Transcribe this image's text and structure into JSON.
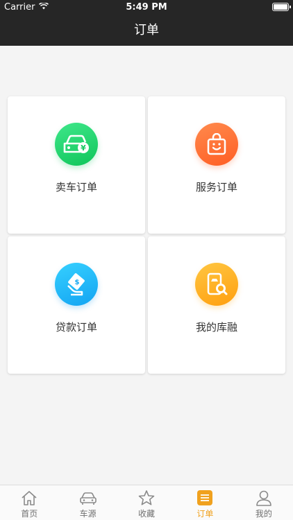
{
  "status_bar": {
    "carrier": "Carrier",
    "time": "5:49 PM"
  },
  "nav": {
    "title": "订单"
  },
  "cards": [
    {
      "label": "卖车订单",
      "icon": "car-yuan-icon",
      "color": "#1dd46a"
    },
    {
      "label": "服务订单",
      "icon": "shopping-bag-icon",
      "color": "#ff6a2f"
    },
    {
      "label": "贷款订单",
      "icon": "loan-card-icon",
      "color": "#20b8f5"
    },
    {
      "label": "我的库融",
      "icon": "phone-search-icon",
      "color": "#ffb21f"
    }
  ],
  "tabbar": {
    "items": [
      {
        "label": "首页",
        "icon": "home-icon"
      },
      {
        "label": "车源",
        "icon": "car-icon"
      },
      {
        "label": "收藏",
        "icon": "star-icon"
      },
      {
        "label": "订单",
        "icon": "order-icon",
        "active": true
      },
      {
        "label": "我的",
        "icon": "user-icon"
      }
    ]
  },
  "colors": {
    "header_bg": "#262626",
    "page_bg": "#f4f4f4",
    "active_tab": "#f0a11e"
  }
}
